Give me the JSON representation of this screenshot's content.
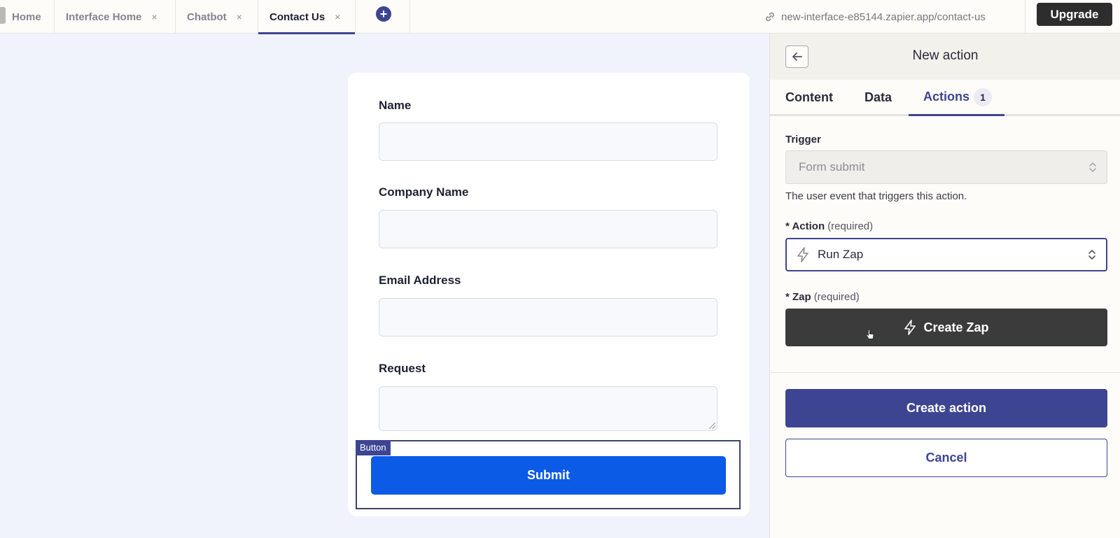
{
  "tabs": [
    {
      "label": "Home",
      "closable": false,
      "active": false
    },
    {
      "label": "Interface Home",
      "closable": true,
      "active": false
    },
    {
      "label": "Chatbot",
      "closable": true,
      "active": false
    },
    {
      "label": "Contact Us",
      "closable": true,
      "active": true
    }
  ],
  "tab_close_glyph": "×",
  "add_tab_glyph": "+",
  "url": "new-interface-e85144.zapier.app/contact-us",
  "upgrade_label": "Upgrade",
  "form": {
    "fields": [
      {
        "label": "Name",
        "value": ""
      },
      {
        "label": "Company Name",
        "value": ""
      },
      {
        "label": "Email Address",
        "value": ""
      },
      {
        "label": "Request",
        "value": ""
      }
    ],
    "button_block_tag": "Button",
    "submit_label": "Submit"
  },
  "panel": {
    "title": "New action",
    "tabs": [
      {
        "label": "Content"
      },
      {
        "label": "Data"
      },
      {
        "label": "Actions",
        "badge": "1",
        "active": true
      }
    ],
    "trigger_label": "Trigger",
    "trigger_value": "Form submit",
    "trigger_help": "The user event that triggers this action.",
    "action_label": "* Action",
    "action_required": "(required)",
    "action_value": "Run Zap",
    "zap_label": "* Zap",
    "zap_required": "(required)",
    "create_zap_label": "Create Zap",
    "create_action_label": "Create action",
    "cancel_label": "Cancel"
  },
  "colors": {
    "accent": "#3d4592",
    "submit_blue": "#0b5be6",
    "dark_button": "#3b3b3b"
  }
}
